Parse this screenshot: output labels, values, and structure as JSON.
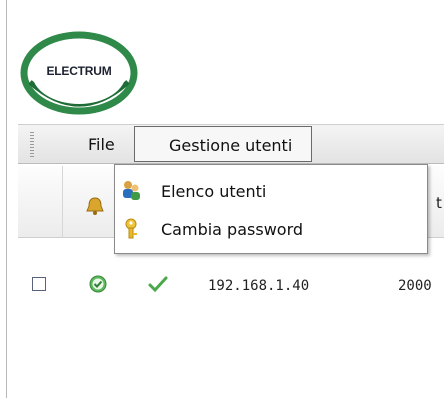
{
  "logo": {
    "text": "ELECTRUM",
    "ring_color": "#2f8a4a"
  },
  "menubar": {
    "items": [
      {
        "label": "File"
      },
      {
        "label": "Gestione utenti"
      }
    ]
  },
  "dropdown": {
    "items": [
      {
        "label": "Elenco utenti",
        "icon": "users-icon"
      },
      {
        "label": "Cambia password",
        "icon": "key-icon"
      }
    ]
  },
  "grid": {
    "header": {
      "bell_icon": "bell-icon",
      "partial_column_label": "t"
    },
    "rows": [
      {
        "checked": false,
        "status_icon": "ok-circle-icon",
        "check_icon": "checkmark-icon",
        "ip": "192.168.1.40",
        "port": "2000"
      }
    ]
  }
}
